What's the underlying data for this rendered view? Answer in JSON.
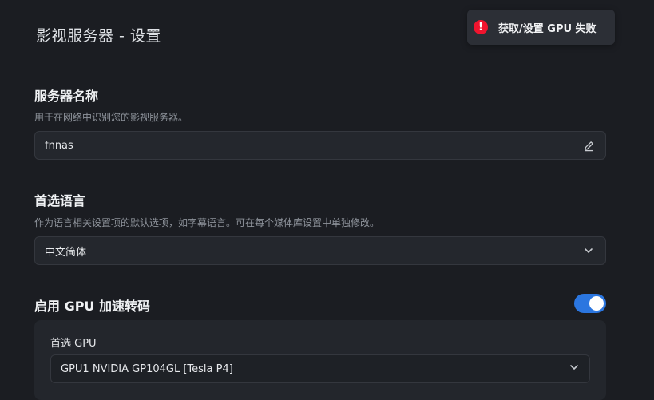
{
  "header": {
    "title": "影视服务器 - 设置"
  },
  "toast": {
    "icon": "error-icon",
    "message": "获取/设置 GPU 失败",
    "color": "#f0142e"
  },
  "server_name": {
    "title": "服务器名称",
    "description": "用于在网络中识别您的影视服务器。",
    "value": "fnnas",
    "icon": "edit-icon"
  },
  "language": {
    "title": "首选语言",
    "description": "作为语言相关设置项的默认选项，如字幕语言。可在每个媒体库设置中单独修改。",
    "selected": "中文简体",
    "icon": "chevron-down-icon"
  },
  "gpu": {
    "title": "启用 GPU 加速转码",
    "enabled": true,
    "accent": "#2b76e0",
    "preferred_label": "首选 GPU",
    "selected": "GPU1 NVIDIA GP104GL [Tesla P4]"
  }
}
